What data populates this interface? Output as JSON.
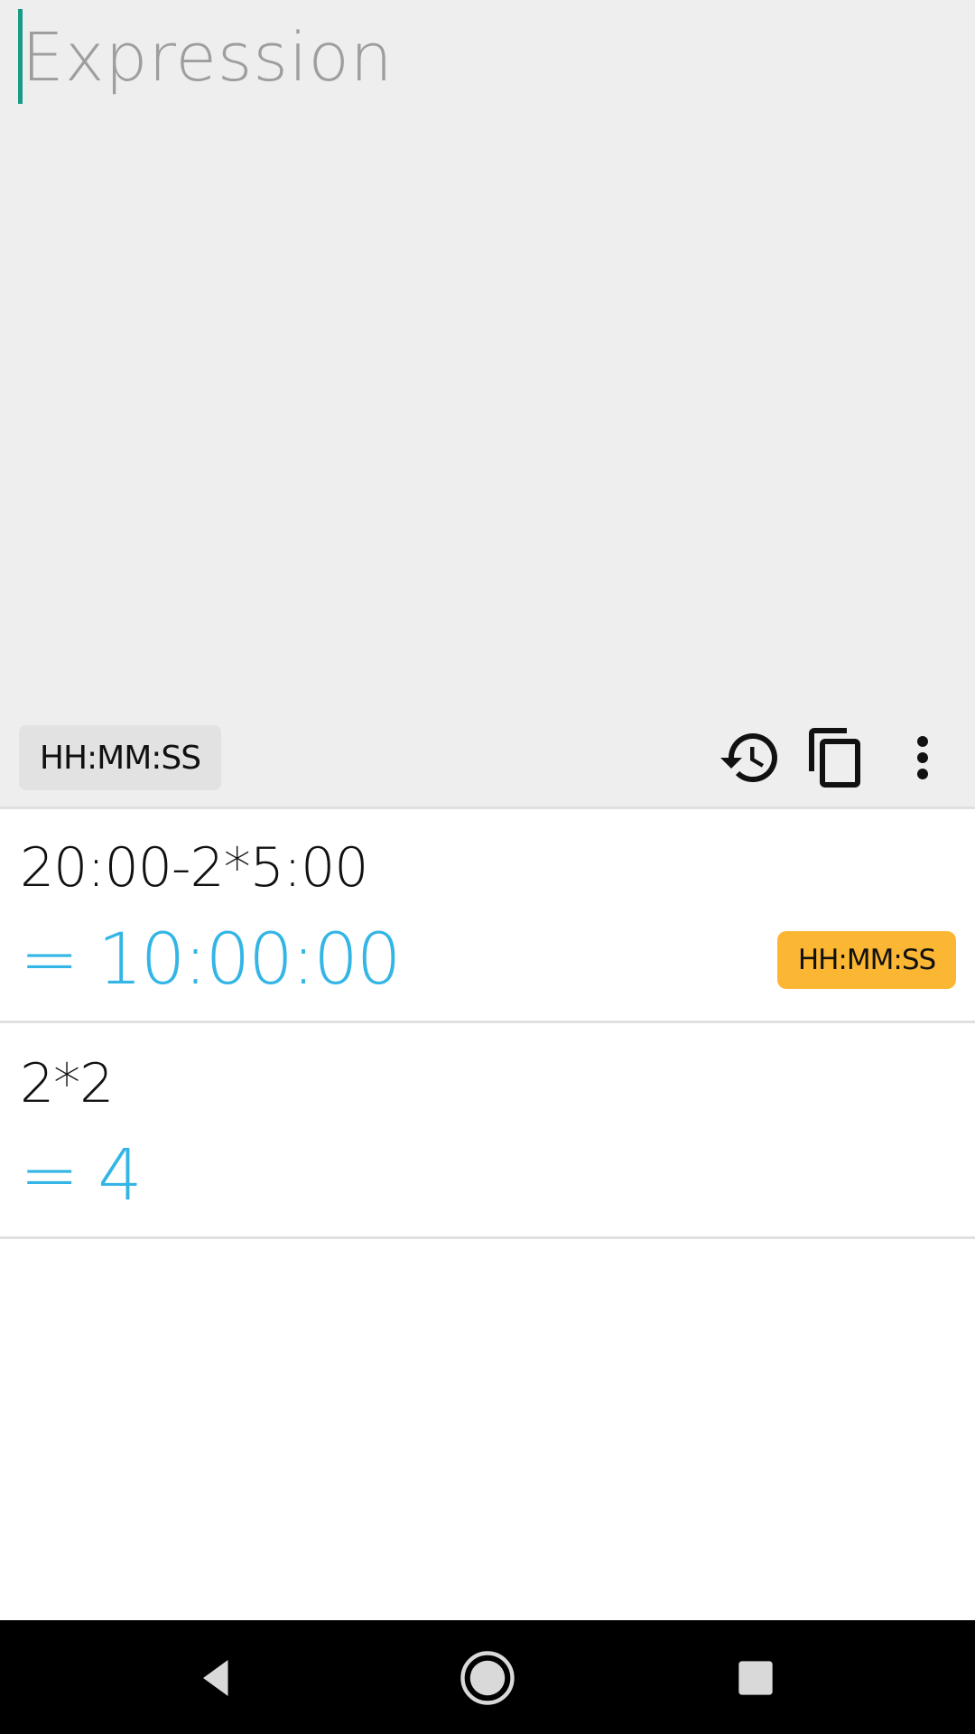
{
  "input": {
    "value": "",
    "placeholder": "Expression"
  },
  "toolbar": {
    "format_label": "HH:MM:SS",
    "icons": [
      "history-icon",
      "copy-icon",
      "more-vert-icon"
    ]
  },
  "history": [
    {
      "expression": "20:00-2*5:00",
      "result": "= 10:00:00",
      "format_label": "HH:MM:SS"
    },
    {
      "expression": "2*2",
      "result": "= 4"
    }
  ],
  "navbar": {
    "icons": [
      "back-icon",
      "home-icon",
      "recents-icon"
    ]
  },
  "colors": {
    "accent": "#33b5e5",
    "cursor": "#1a9a85",
    "chip_highlight": "#fbb733",
    "input_background": "#eeeeee"
  }
}
